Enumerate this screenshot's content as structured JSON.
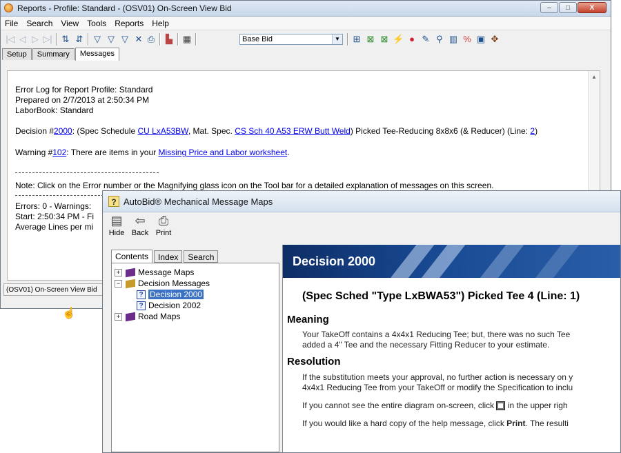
{
  "main_window": {
    "title": "Reports - Profile: Standard - (OSV01) On-Screen View Bid",
    "controls": {
      "minimize": "–",
      "maximize": "□",
      "close": "X"
    },
    "menu": [
      "File",
      "Search",
      "View",
      "Tools",
      "Reports",
      "Help"
    ],
    "toolbar": {
      "bid_select_value": "Base Bid"
    },
    "tabs": [
      "Setup",
      "Summary",
      "Messages"
    ],
    "active_tab": "Messages",
    "log": {
      "header_line1": "Error Log for Report Profile: Standard",
      "header_line2": "Prepared on 2/7/2013 at 2:50:34 PM",
      "header_line3": "LaborBook: Standard",
      "decision": {
        "prefix": "Decision #",
        "number": "2000",
        "part1": ": (Spec Schedule ",
        "link_spec": "CU LxA53BW",
        "part2": ", Mat. Spec. ",
        "link_mat": "CS Sch 40 A53 ERW Butt Weld",
        "part3": ") Picked Tee-Reducing 8x8x6 (& Reducer) (Line: ",
        "line_link": "2",
        "part4": ")"
      },
      "warning": {
        "prefix": "Warning #",
        "number": "102",
        "part1": ": There are items in your ",
        "link": "Missing Price and Labor worksheet",
        "part2": "."
      },
      "note": "Note: Click on the Error number or the Magnifying glass icon on the Tool bar for a detailed explanation of messages on this screen.",
      "errors_line": "Errors: 0 - Warnings:",
      "start_line": "Start: 2:50:34 PM - Fi",
      "average_line": "Average Lines per mi"
    },
    "status": "(OSV01) On-Screen View Bid"
  },
  "help_window": {
    "title": "AutoBid® Mechanical Message Maps",
    "toolbar": [
      "Hide",
      "Back",
      "Print"
    ],
    "nav_tabs": [
      "Contents",
      "Index",
      "Search"
    ],
    "tree": [
      {
        "label": "Message Maps",
        "type": "book",
        "expander": "+"
      },
      {
        "label": "Decision Messages",
        "type": "book-open",
        "expander": "−"
      },
      {
        "label": "Decision 2000",
        "type": "page",
        "selected": true
      },
      {
        "label": "Decision 2002",
        "type": "page",
        "selected": false
      },
      {
        "label": "Road Maps",
        "type": "book",
        "expander": "+"
      }
    ],
    "topic": {
      "banner": "Decision 2000",
      "heading": "(Spec Sched \"Type LxBWA53\") Picked Tee 4 (Line: 1)",
      "meaning_title": "Meaning",
      "meaning_line1": "Your TakeOff contains a 4x4x1 Reducing Tee; but, there was no such Tee",
      "meaning_line2": "added a 4\" Tee and the necessary Fitting Reducer to your estimate.",
      "resolution_title": "Resolution",
      "res_line1": "If the substitution meets your approval, no further action is necessary on y",
      "res_line2": "4x4x1 Reducing Tee from your TakeOff or modify the Specification to inclu",
      "res_line3_a": "If you cannot see the entire diagram on-screen, click ",
      "res_line3_b": " in the upper righ",
      "res_line4_a": "If you would like a hard copy of the help message, click ",
      "res_line4_b": "Print",
      "res_line4_c": ". The resulti"
    }
  },
  "colors": {
    "link": "#0000ee",
    "banner": "#184a93",
    "selection": "#3b72c4"
  }
}
